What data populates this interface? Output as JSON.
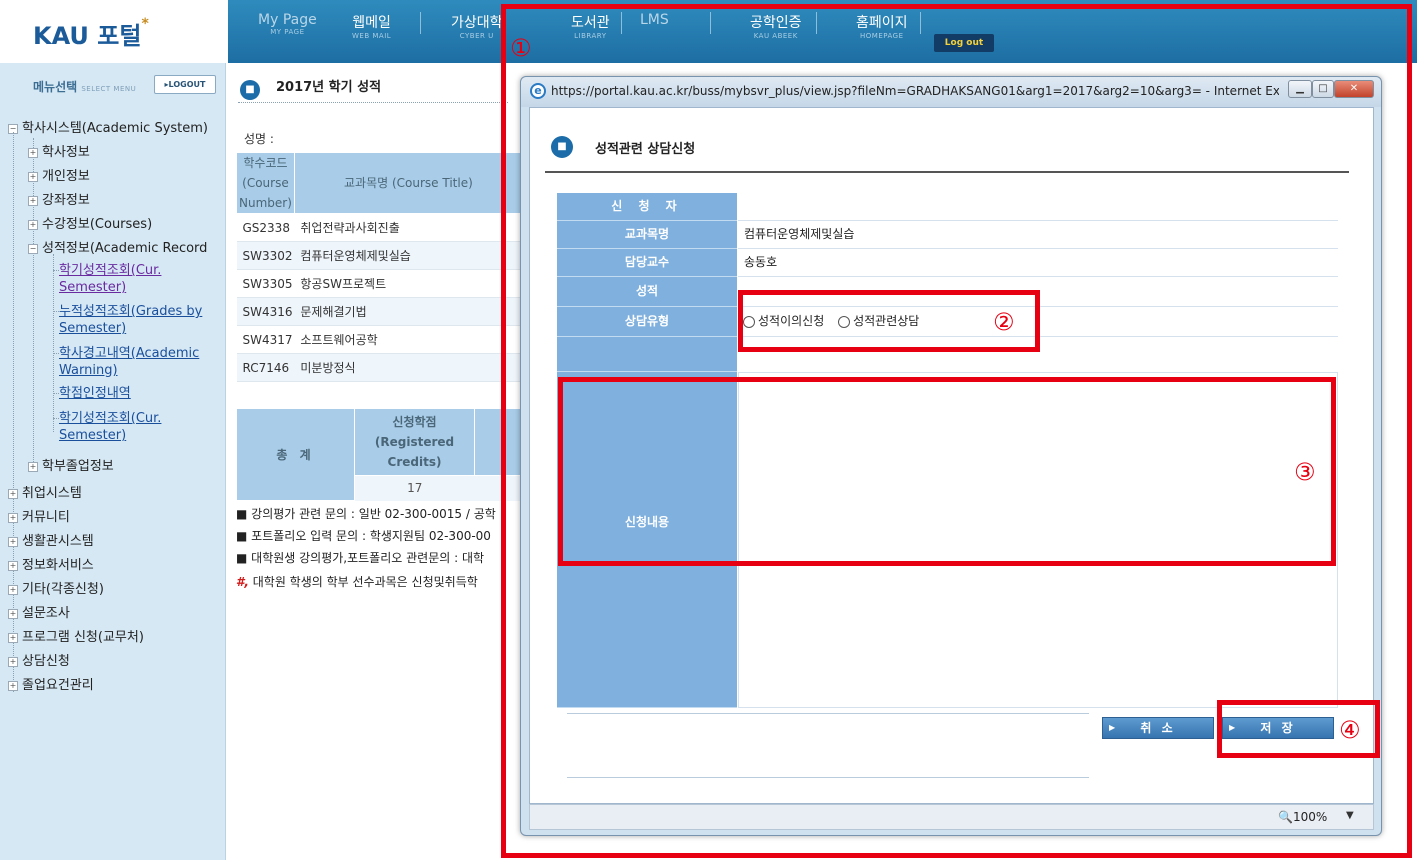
{
  "header": {
    "logo": "KAU 포털",
    "nav": [
      {
        "title": "My Page",
        "sub": "MY PAGE"
      },
      {
        "title": "웹메일",
        "sub": "WEB MAIL"
      },
      {
        "title": "가상대학",
        "sub": "CYBER U"
      },
      {
        "title": "도서관",
        "sub": "LIBRARY"
      },
      {
        "title": "LMS",
        "sub": ""
      },
      {
        "title": "공학인증",
        "sub": "KAU ABEEK"
      },
      {
        "title": "홈페이지",
        "sub": "HOMEPAGE"
      }
    ],
    "logout": "Log out"
  },
  "sidebar": {
    "menu_label": "메뉴선택",
    "menu_sub": "SELECT MENU",
    "logout_button": "LOGOUT",
    "root": "학사시스템(Academic System)",
    "items": [
      "학사정보",
      "개인정보",
      "강좌정보",
      "수강정보(Courses)",
      "성적정보(Academic Record"
    ],
    "sub_links": [
      "학기성적조회(Cur. Semester)",
      "누적성적조회(Grades by Semester)",
      "학사경고내역(Academic Warning)",
      "학점인정내역",
      "학기성적조회(Cur. Semester)"
    ],
    "sub_item_after": "학부졸업정보",
    "top_items": [
      "취업시스템",
      "커뮤니티",
      "생활관시스템",
      "정보화서비스",
      "기타(각종신청)",
      "설문조사",
      "프로그램 신청(교무처)",
      "상담신청",
      "졸업요건관리"
    ]
  },
  "main": {
    "title": "2017년   학기 성적",
    "name_label": "성명 :",
    "table_headers": {
      "code": "학수코드 (Course Number)",
      "course": "교과목명 (Course Title)"
    },
    "rows": [
      {
        "code": "GS2338",
        "course": "취업전략과사회진출"
      },
      {
        "code": "SW3302",
        "course": "컴퓨터운영체제및실습"
      },
      {
        "code": "SW3305",
        "course": "항공SW프로젝트"
      },
      {
        "code": "SW4316",
        "course": "문제해결기법"
      },
      {
        "code": "SW4317",
        "course": "소프트웨어공학"
      },
      {
        "code": "RC7146",
        "course": "미분방정식"
      }
    ],
    "total_label": "총  계",
    "credits_header": "신청학점 (Registered Credits)",
    "credits_value": "17",
    "notes": [
      "■ 강의평가 관련 문의 : 일반 02-300-0015 / 공학",
      "■ 포트폴리오 입력 문의 : 학생지원팀 02-300-00",
      "■ 대학원생 강의평가,포트폴리오 관련문의 : 대학"
    ],
    "note_red": "대학원 학생의 학부 선수과목은 신청및취득학"
  },
  "popup": {
    "url": "https://portal.kau.ac.kr/buss/mybsvr_plus/view.jsp?fileNm=GRADHAKSANG01&arg1=2017&arg2=10&arg3= - Internet Expl...",
    "form_title": "성적관련 상담신청",
    "fields": {
      "applicant_label": "신 청 자",
      "applicant_value": "",
      "course_label": "교과목명",
      "course_value": "컴퓨터운영체제및실습",
      "professor_label": "담당교수",
      "professor_value": "송동호",
      "grade_label": "성적",
      "grade_value": "",
      "type_label": "상담유형",
      "type_options": [
        "성적이의신청",
        "성적관련상담"
      ],
      "content_label": "신청내용"
    },
    "cancel_button": "취 소",
    "save_button": "저 장",
    "zoom": "100%"
  },
  "annotations": {
    "m1": "①",
    "m2": "②",
    "m3": "③",
    "m4": "④"
  },
  "colors": {
    "accent": "#1d6ea3",
    "annotation": "#e60012",
    "label_bg": "#7fb0de"
  }
}
